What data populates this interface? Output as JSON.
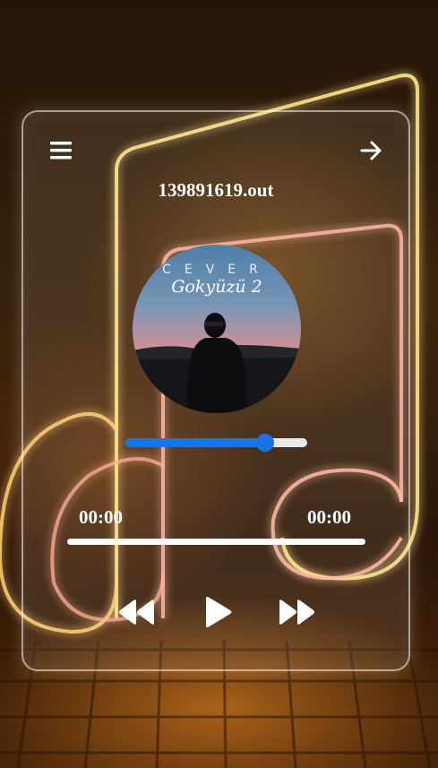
{
  "track": {
    "title": "139891619.out",
    "cover_text_top": "CEVER",
    "cover_text_sub": "Gokyüzü 2"
  },
  "player": {
    "current_time": "00:00",
    "duration": "00:00",
    "progress_fraction": 0,
    "volume_fraction": 0.77
  },
  "icons": {
    "menu": "menu-icon",
    "exit": "arrow-right-icon",
    "rewind": "rewind-icon",
    "play": "play-icon",
    "forward": "fast-forward-icon"
  },
  "colors": {
    "accent": "#1b73ea",
    "text": "#ffffff"
  }
}
